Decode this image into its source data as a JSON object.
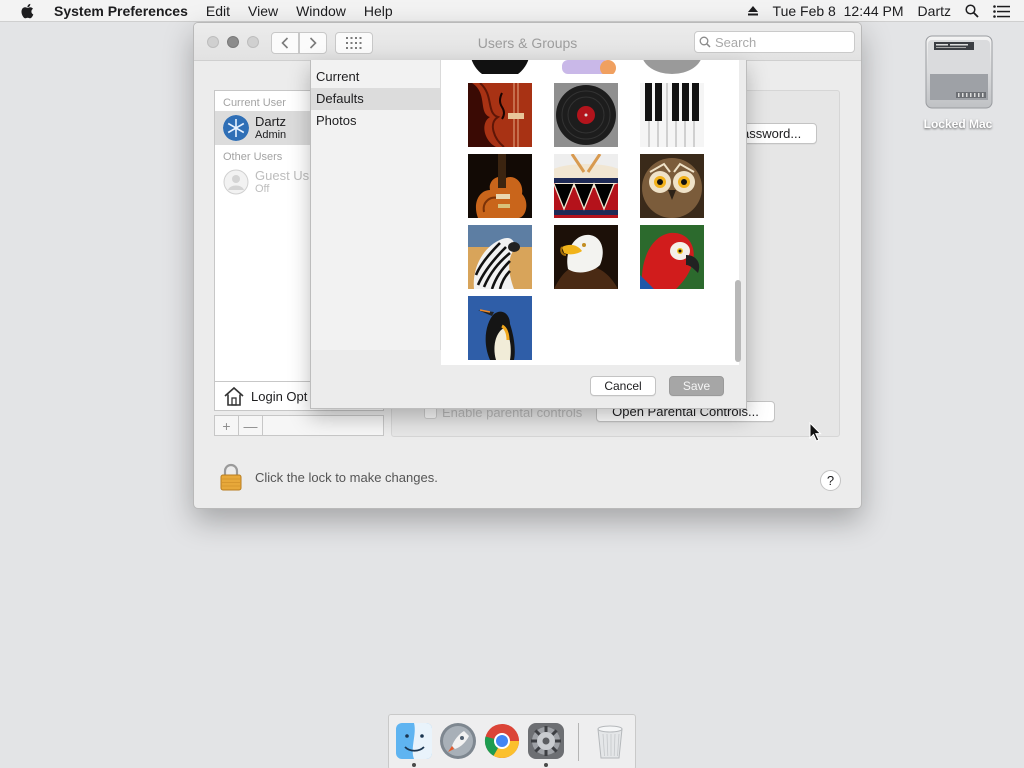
{
  "menubar": {
    "app_name": "System Preferences",
    "menus": [
      "Edit",
      "View",
      "Window",
      "Help"
    ],
    "clock": "Tue Feb 8  12:44 PM",
    "user": "Dartz"
  },
  "desktop": {
    "disk_label": "Locked Mac"
  },
  "window": {
    "title": "Users & Groups",
    "search_placeholder": "Search",
    "current_user_header": "Current User",
    "current_user": {
      "name": "Dartz",
      "role": "Admin"
    },
    "other_users_header": "Other Users",
    "guest_user": {
      "name": "Guest Us",
      "status": "Off"
    },
    "login_options": "Login Opt",
    "add_symbol": "+",
    "remove_symbol": "—",
    "change_password_button": "assword...",
    "enable_parental_label": "Enable parental controls",
    "open_parental_button": "Open Parental Controls...",
    "lock_text": "Click the lock to make changes.",
    "help_symbol": "?"
  },
  "picker": {
    "sources": [
      "Current",
      "Defaults",
      "Photos"
    ],
    "selected_source": "Defaults",
    "pictures": [
      "violin",
      "vinyl-record",
      "piano-keys",
      "guitar",
      "drum",
      "owl",
      "zebra",
      "eagle",
      "parrot",
      "penguin"
    ],
    "cancel_label": "Cancel",
    "save_label": "Save"
  },
  "dock": {
    "apps": [
      "Finder",
      "Launchpad",
      "Google Chrome",
      "System Preferences",
      "Trash"
    ]
  },
  "colors": {
    "accent_selection": "#dcdcdc",
    "save_button": "#a6a6a6",
    "desktop": "#e3e4e6"
  }
}
